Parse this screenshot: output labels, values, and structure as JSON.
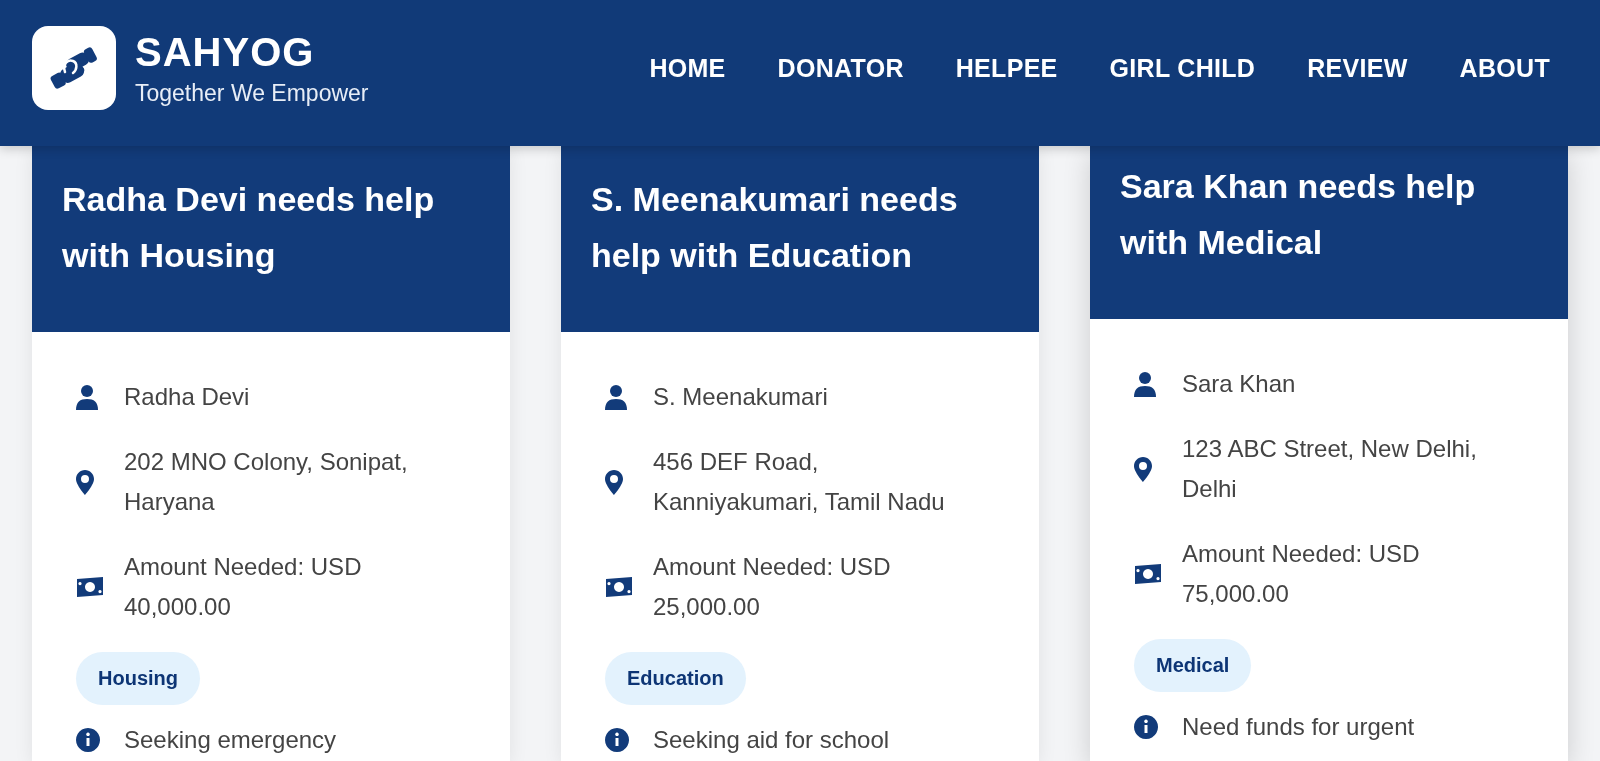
{
  "header": {
    "brand": "SAHYOG",
    "tagline": "Together We Empower"
  },
  "nav": [
    "HOME",
    "DONATOR",
    "HELPEE",
    "GIRL CHILD",
    "REVIEW",
    "ABOUT"
  ],
  "cards": [
    {
      "title": "Radha Devi needs help with Housing",
      "hovered": false,
      "name": "Radha Devi",
      "address": "202 MNO Colony, Sonipat, Haryana",
      "amount": "Amount Needed: USD 40,000.00",
      "category": "Housing",
      "description": "Seeking emergency"
    },
    {
      "title": "S. Meenakumari needs help with Education",
      "hovered": false,
      "name": "S. Meenakumari",
      "address": "456 DEF Road, Kanniyakumari, Tamil Nadu",
      "amount": "Amount Needed: USD 25,000.00",
      "category": "Education",
      "description": "Seeking aid for school"
    },
    {
      "title": "Sara Khan needs help with Medical",
      "hovered": true,
      "name": "Sara Khan",
      "address": "123 ABC Street, New Delhi, Delhi",
      "amount": "Amount Needed: USD 75,000.00",
      "category": "Medical",
      "description": "Need funds for urgent"
    }
  ]
}
